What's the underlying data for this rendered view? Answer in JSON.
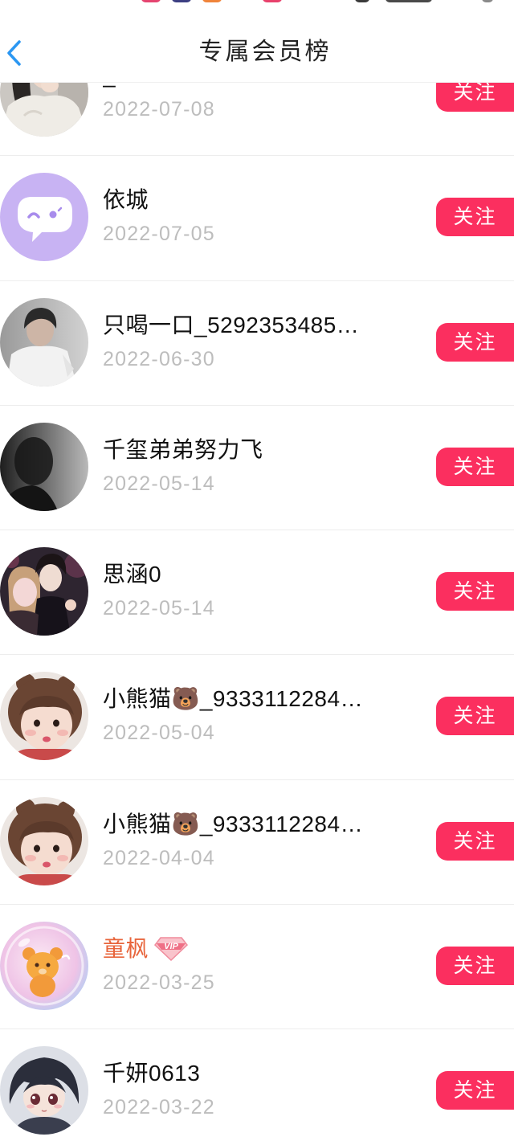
{
  "status_bar": {
    "icon_colors": [
      "#e54470",
      "#3c3f82",
      "#f0843a",
      "#e8416c",
      "#3a3a3a",
      "#4a4a4a",
      "#8a8a8a"
    ]
  },
  "header": {
    "title": "专属会员榜",
    "back_icon": "chevron-left-icon"
  },
  "colors": {
    "accent": "#2b97f2",
    "follow_button": "#fb2f5f",
    "date_text": "#bdbdbd",
    "name_text": "#111111"
  },
  "labels": {
    "follow": "关注"
  },
  "members": [
    {
      "name": "_",
      "date": "2022-07-08"
    },
    {
      "name": "依城",
      "date": "2022-07-05"
    },
    {
      "name": "只喝一口_5292353485…",
      "date": "2022-06-30"
    },
    {
      "name": "千玺弟弟努力飞",
      "date": "2022-05-14"
    },
    {
      "name": "思涵0",
      "date": "2022-05-14"
    },
    {
      "name": "小熊猫🐻_9333112284…",
      "date": "2022-05-04"
    },
    {
      "name": "小熊猫🐻_9333112284…",
      "date": "2022-04-04"
    },
    {
      "name": "童枫",
      "date": "2022-03-25",
      "name_color": "#e8653c",
      "badge": "VIP",
      "badge_icon": "diamond-icon"
    },
    {
      "name": "千妍0613",
      "date": "2022-03-22"
    }
  ]
}
